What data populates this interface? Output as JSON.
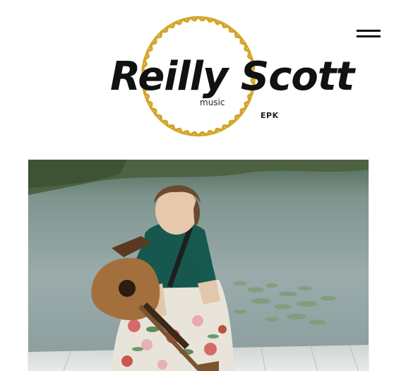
{
  "header": {
    "logo": {
      "name": "Reilly Scott",
      "subtitle": "music",
      "tag": "EPK",
      "wreath_color": "#d4a52a"
    },
    "menu_icon": "hamburger-menu-icon"
  },
  "main": {
    "hero_image": {
      "subject": "woman-with-acoustic-guitar-on-dock",
      "water_color": "#8fa3a6",
      "top_color": "#5d6e4f"
    }
  }
}
